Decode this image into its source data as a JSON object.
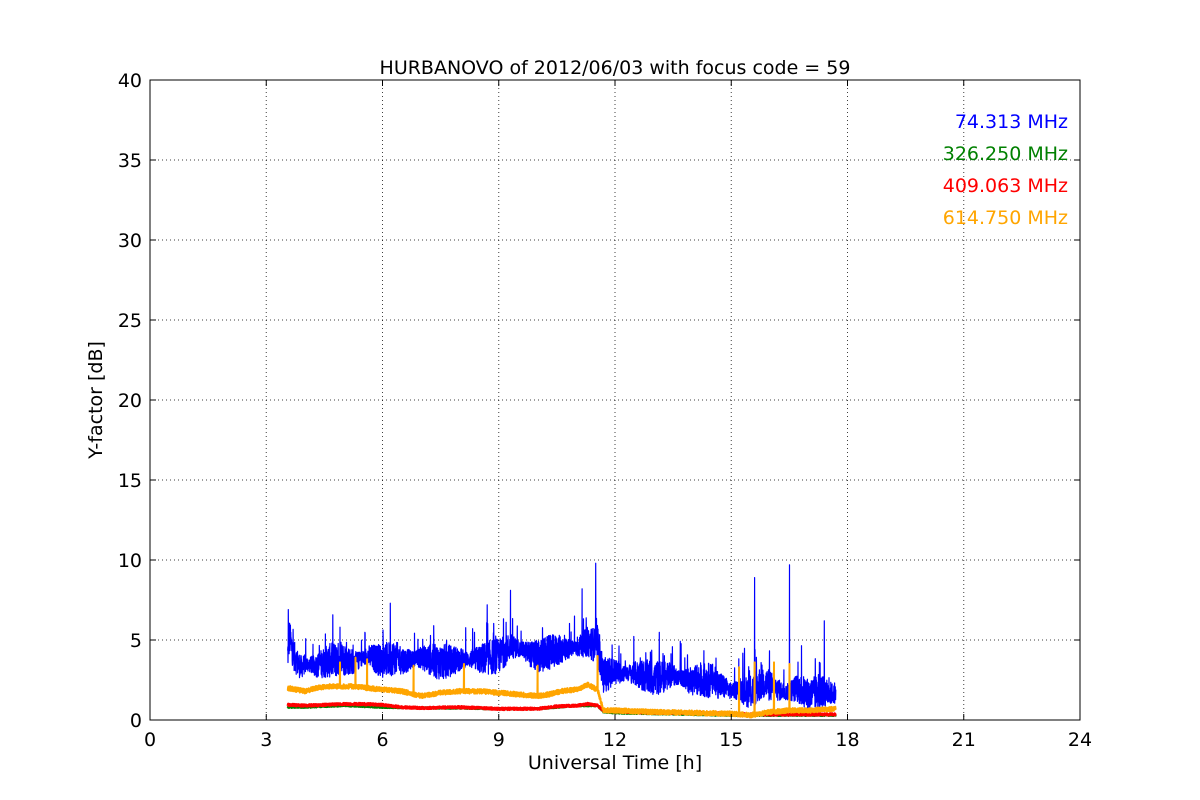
{
  "chart_data": {
    "type": "line",
    "title": "HURBANOVO of 2012/06/03 with focus code = 59",
    "xlabel": "Universal Time [h]",
    "ylabel": "Y-factor [dB]",
    "xlim": [
      0,
      24
    ],
    "ylim": [
      0,
      40
    ],
    "xticks": [
      0,
      3,
      6,
      9,
      12,
      15,
      18,
      21,
      24
    ],
    "yticks": [
      0,
      5,
      10,
      15,
      20,
      25,
      30,
      35,
      40
    ],
    "grid": true,
    "legend_position": "top-right",
    "series": [
      {
        "name": "74.313 MHz",
        "color": "#0000ff",
        "x": [
          3.55,
          3.6,
          3.7,
          3.8,
          3.9,
          4.0,
          4.3,
          4.6,
          5.0,
          5.3,
          5.6,
          6.0,
          6.3,
          6.6,
          7.0,
          7.5,
          8.0,
          8.5,
          9.0,
          9.3,
          9.6,
          10.0,
          10.3,
          10.6,
          11.0,
          11.3,
          11.55,
          11.7,
          12.0,
          12.5,
          13.0,
          13.5,
          14.0,
          14.5,
          15.0,
          15.2,
          15.5,
          15.8,
          16.1,
          16.4,
          16.7,
          17.0,
          17.3,
          17.7
        ],
        "y": [
          4.0,
          5.2,
          4.1,
          3.6,
          3.3,
          3.5,
          3.4,
          3.7,
          3.8,
          3.6,
          4.0,
          3.7,
          3.9,
          3.7,
          3.9,
          3.6,
          3.8,
          3.8,
          4.0,
          4.6,
          4.4,
          3.9,
          4.2,
          4.4,
          4.5,
          4.9,
          4.6,
          2.8,
          3.0,
          2.9,
          2.6,
          2.8,
          2.4,
          2.5,
          1.8,
          1.9,
          1.7,
          2.4,
          2.0,
          1.7,
          2.0,
          1.5,
          1.8,
          1.6
        ],
        "peaks": [
          [
            3.57,
            6.9
          ],
          [
            4.9,
            5.8
          ],
          [
            6.2,
            7.3
          ],
          [
            8.7,
            7.2
          ],
          [
            9.3,
            8.1
          ],
          [
            11.15,
            8.2
          ],
          [
            11.5,
            9.8
          ],
          [
            15.6,
            8.9
          ],
          [
            16.5,
            9.7
          ],
          [
            17.4,
            6.2
          ]
        ]
      },
      {
        "name": "326.250 MHz",
        "color": "#008000",
        "x": [
          3.55,
          4.0,
          4.5,
          5.0,
          5.5,
          6.0,
          7.0,
          8.0,
          9.0,
          10.0,
          11.0,
          11.55,
          11.7,
          12.0,
          13.0,
          14.0,
          15.0,
          16.0,
          17.0,
          17.7
        ],
        "y": [
          0.8,
          0.8,
          0.85,
          0.9,
          0.85,
          0.8,
          0.75,
          0.75,
          0.7,
          0.7,
          0.9,
          0.9,
          0.5,
          0.45,
          0.4,
          0.35,
          0.3,
          0.3,
          0.3,
          0.3
        ],
        "peaks": []
      },
      {
        "name": "409.063 MHz",
        "color": "#ff0000",
        "x": [
          3.55,
          4.0,
          4.5,
          5.0,
          5.5,
          6.0,
          6.5,
          7.0,
          8.0,
          9.0,
          10.0,
          10.5,
          11.0,
          11.3,
          11.55,
          11.7,
          12.0,
          13.0,
          14.0,
          15.0,
          15.5,
          16.0,
          16.5,
          17.0,
          17.7
        ],
        "y": [
          0.95,
          0.9,
          0.95,
          1.0,
          1.0,
          0.95,
          0.8,
          0.75,
          0.8,
          0.7,
          0.7,
          0.85,
          0.9,
          1.0,
          0.9,
          0.6,
          0.55,
          0.45,
          0.45,
          0.4,
          0.35,
          0.35,
          0.35,
          0.35,
          0.35
        ],
        "peaks": []
      },
      {
        "name": "614.750 MHz",
        "color": "#ffa500",
        "x": [
          3.55,
          4.0,
          4.3,
          4.6,
          5.0,
          5.3,
          5.6,
          6.0,
          6.5,
          7.0,
          7.5,
          8.0,
          8.5,
          9.0,
          9.5,
          10.0,
          10.3,
          10.6,
          11.0,
          11.3,
          11.55,
          11.7,
          12.0,
          13.0,
          14.0,
          15.0,
          15.5,
          16.0,
          16.5,
          17.0,
          17.7
        ],
        "y": [
          2.0,
          1.8,
          2.0,
          2.1,
          2.1,
          2.1,
          2.0,
          1.9,
          1.8,
          1.5,
          1.7,
          1.8,
          1.8,
          1.7,
          1.6,
          1.5,
          1.6,
          1.8,
          1.9,
          2.2,
          1.9,
          0.6,
          0.6,
          0.5,
          0.45,
          0.4,
          0.3,
          0.5,
          0.6,
          0.6,
          0.7
        ],
        "peaks": [
          [
            4.9,
            3.6
          ],
          [
            5.3,
            3.9
          ],
          [
            5.6,
            3.8
          ],
          [
            6.8,
            3.4
          ],
          [
            8.1,
            3.5
          ],
          [
            10.0,
            3.4
          ],
          [
            11.55,
            4.0
          ],
          [
            15.2,
            3.3
          ],
          [
            15.6,
            3.6
          ],
          [
            16.1,
            3.6
          ],
          [
            16.5,
            3.5
          ]
        ]
      }
    ]
  }
}
